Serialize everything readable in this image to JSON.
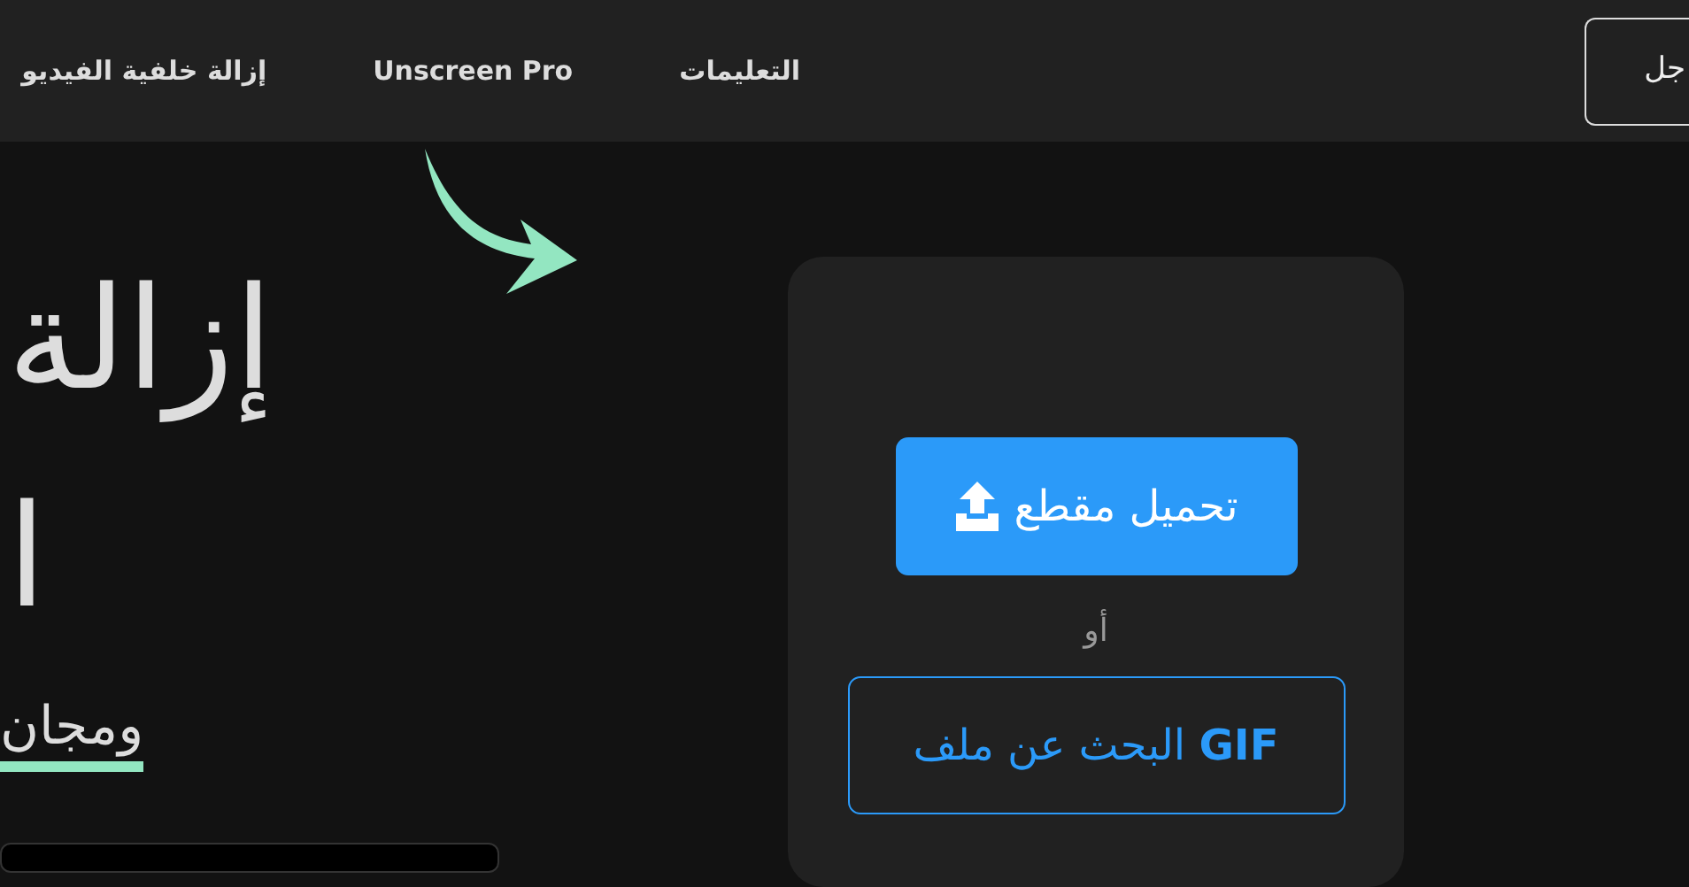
{
  "navbar": {
    "login_button": "جل",
    "links": [
      {
        "label": "التعليمات"
      },
      {
        "label": "Unscreen Pro"
      },
      {
        "label": "إزالة خلفية الفيديو"
      }
    ]
  },
  "hero": {
    "title_lines": [
      "إزالة",
      "ا"
    ],
    "subtitle": "ومجان"
  },
  "upload_panel": {
    "upload_button": "تحميل مقطع",
    "separator": "أو",
    "gif_button": "**GIF** البحث عن ملف"
  }
}
